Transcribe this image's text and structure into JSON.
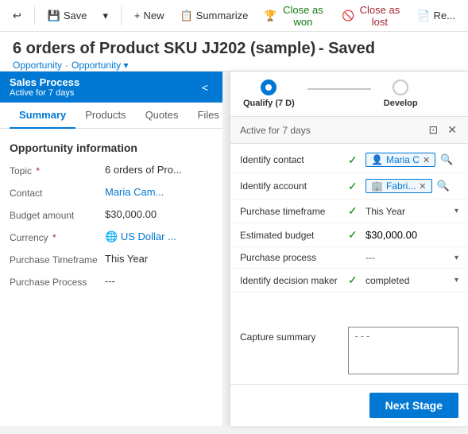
{
  "toolbar": {
    "back_icon": "↩",
    "save_label": "Save",
    "dropdown_icon": "▾",
    "new_label": "New",
    "summarize_label": "Summarize",
    "close_won_label": "Close as won",
    "close_lost_label": "Close as lost",
    "record_label": "Re..."
  },
  "header": {
    "title": "6 orders of Product SKU JJ202 (sample)",
    "saved": "- Saved",
    "breadcrumb1": "Opportunity",
    "breadcrumb2": "Opportunity",
    "breadcrumb_sep": "·"
  },
  "sales_process": {
    "title": "Sales Process",
    "subtitle": "Active for 7 days",
    "collapse_icon": "<"
  },
  "tabs": [
    {
      "label": "Summary",
      "active": true
    },
    {
      "label": "Products",
      "active": false
    },
    {
      "label": "Quotes",
      "active": false
    },
    {
      "label": "Files",
      "active": false
    }
  ],
  "form": {
    "section_title": "Opportunity information",
    "fields": [
      {
        "label": "Topic",
        "required": true,
        "value": "6 orders of Pro..."
      },
      {
        "label": "Contact",
        "required": false,
        "value": "Maria Cam...",
        "link": true
      },
      {
        "label": "Budget amount",
        "required": false,
        "value": "$30,000.00"
      },
      {
        "label": "Currency",
        "required": true,
        "value": "US Dollar ...",
        "link": true
      },
      {
        "label": "Purchase Timeframe",
        "required": false,
        "value": "This Year"
      },
      {
        "label": "Purchase Process",
        "required": false,
        "value": "---"
      }
    ]
  },
  "right_panel": {
    "stage_active": {
      "label": "Qualify (7 D)"
    },
    "stage_next": {
      "label": "Develop"
    },
    "subheader_text": "Active for 7 days",
    "expand_icon": "⊡",
    "close_icon": "✕",
    "rows": [
      {
        "label": "Identify contact",
        "checked": true,
        "value_type": "tag",
        "tag_text": "Maria C",
        "search": true
      },
      {
        "label": "Identify account",
        "checked": true,
        "value_type": "tag",
        "tag_text": "Fabri...",
        "search": true
      },
      {
        "label": "Purchase timeframe",
        "checked": true,
        "value_type": "dropdown",
        "dropdown_text": "This Year"
      },
      {
        "label": "Estimated budget",
        "checked": true,
        "value_type": "text",
        "text": "$30,000.00"
      },
      {
        "label": "Purchase process",
        "checked": false,
        "value_type": "dashes",
        "text": "---"
      },
      {
        "label": "Identify decision maker",
        "checked": true,
        "value_type": "completed_dropdown",
        "text": "completed"
      }
    ],
    "capture_summary_label": "Capture summary",
    "capture_summary_placeholder": "---",
    "next_stage_label": "Next Stage"
  }
}
